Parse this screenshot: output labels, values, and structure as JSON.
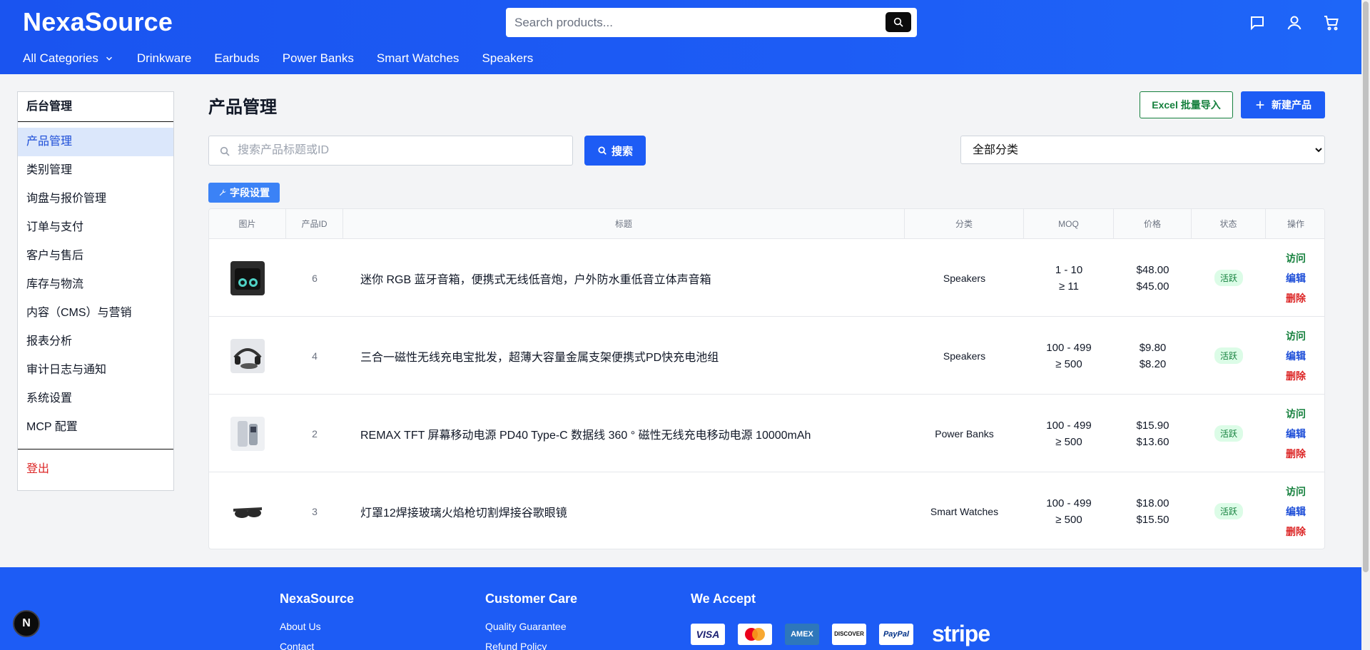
{
  "header": {
    "logo": "NexaSource",
    "search_placeholder": "Search products...",
    "nav": [
      {
        "label": "All Categories"
      },
      {
        "label": "Drinkware"
      },
      {
        "label": "Earbuds"
      },
      {
        "label": "Power Banks"
      },
      {
        "label": "Smart Watches"
      },
      {
        "label": "Speakers"
      }
    ]
  },
  "sidebar": {
    "title": "后台管理",
    "items": [
      {
        "label": "产品管理",
        "active": true
      },
      {
        "label": "类别管理"
      },
      {
        "label": "询盘与报价管理"
      },
      {
        "label": "订单与支付"
      },
      {
        "label": "客户与售后"
      },
      {
        "label": "库存与物流"
      },
      {
        "label": "内容（CMS）与营销"
      },
      {
        "label": "报表分析"
      },
      {
        "label": "审计日志与通知"
      },
      {
        "label": "系统设置"
      },
      {
        "label": "MCP 配置"
      }
    ],
    "logout": "登出"
  },
  "main": {
    "title": "产品管理",
    "import_label": "Excel 批量导入",
    "new_label": "新建产品",
    "filter_placeholder": "搜索产品标题或ID",
    "search_label": "搜索",
    "category_selected": "全部分类",
    "fields_label": "字段设置"
  },
  "table": {
    "headers": [
      "图片",
      "产品ID",
      "标题",
      "分类",
      "MOQ",
      "价格",
      "状态",
      "操作"
    ],
    "rows": [
      {
        "id": "6",
        "title": "迷你 RGB 蓝牙音箱，便携式无线低音炮，户外防水重低音立体声音箱",
        "category": "Speakers",
        "moq1": "1 - 10",
        "moq2": "≥ 11",
        "price1": "$48.00",
        "price2": "$45.00",
        "status": "活跃",
        "visit": "访问",
        "edit": "编辑",
        "delete": "删除",
        "thumb": "speaker"
      },
      {
        "id": "4",
        "title": "三合一磁性无线充电宝批发，超薄大容量金属支架便携式PD快充电池组",
        "category": "Speakers",
        "moq1": "100 - 499",
        "moq2": "≥ 500",
        "price1": "$9.80",
        "price2": "$8.20",
        "status": "活跃",
        "visit": "访问",
        "edit": "编辑",
        "delete": "删除",
        "thumb": "charger"
      },
      {
        "id": "2",
        "title": "REMAX TFT 屏幕移动电源 PD40 Type-C 数据线 360 ° 磁性无线充电移动电源 10000mAh",
        "category": "Power Banks",
        "moq1": "100 - 499",
        "moq2": "≥ 500",
        "price1": "$15.90",
        "price2": "$13.60",
        "status": "活跃",
        "visit": "访问",
        "edit": "编辑",
        "delete": "删除",
        "thumb": "powerbank"
      },
      {
        "id": "3",
        "title": "灯罩12焊接玻璃火焰枪切割焊接谷歌眼镜",
        "category": "Smart Watches",
        "moq1": "100 - 499",
        "moq2": "≥ 500",
        "price1": "$18.00",
        "price2": "$15.50",
        "status": "活跃",
        "visit": "访问",
        "edit": "编辑",
        "delete": "删除",
        "thumb": "glasses"
      }
    ]
  },
  "footer": {
    "col1": {
      "heading": "NexaSource",
      "links": [
        "About Us",
        "Contact"
      ]
    },
    "col2": {
      "heading": "Customer Care",
      "links": [
        "Quality Guarantee",
        "Refund Policy"
      ]
    },
    "col3": {
      "heading": "We Accept",
      "cards": [
        "VISA",
        "mastercard",
        "AMEX",
        "DISCOVER",
        "PayPal"
      ],
      "stripe": "stripe"
    }
  },
  "devtools_badge": "N",
  "colors": {
    "primary": "#1d5cf5",
    "success": "#15803d",
    "danger": "#dc2626"
  }
}
